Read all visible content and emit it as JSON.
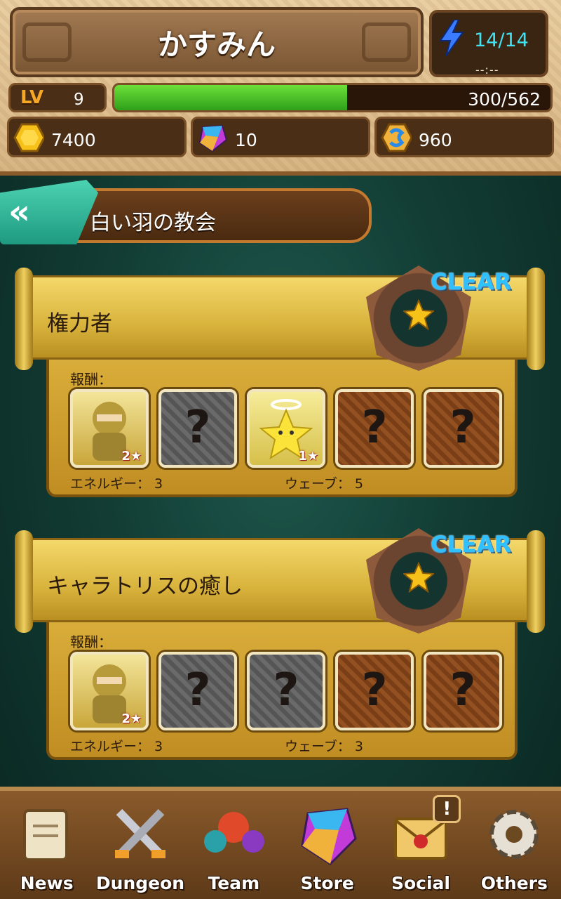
{
  "header": {
    "player_name": "かすみん",
    "stamina": "14/14",
    "stamina_timer": "--:--",
    "level_tag": "LV",
    "level": "9",
    "exp_text": "300/562",
    "exp_progress": 0.534,
    "currencies": {
      "gold": "7400",
      "gems": "10",
      "tickets": "960"
    }
  },
  "area": {
    "title": "白い羽の教会"
  },
  "quests": [
    {
      "title": "権力者",
      "status": "CLEAR",
      "reward_label": "報酬：",
      "rewards": [
        {
          "type": "ninja",
          "rarity": "2★"
        },
        {
          "type": "unknown-silver",
          "symbol": "?"
        },
        {
          "type": "angel-star",
          "rarity": "1★"
        },
        {
          "type": "unknown-bronze",
          "symbol": "?"
        },
        {
          "type": "unknown-bronze",
          "symbol": "?"
        }
      ],
      "energy": "エネルギー： 3",
      "waves": "ウェーブ： 5"
    },
    {
      "title": "キャラトリスの癒し",
      "status": "CLEAR",
      "reward_label": "報酬：",
      "rewards": [
        {
          "type": "ninja",
          "rarity": "2★"
        },
        {
          "type": "unknown-silver",
          "symbol": "?"
        },
        {
          "type": "unknown-silver",
          "symbol": "?"
        },
        {
          "type": "unknown-bronze",
          "symbol": "?"
        },
        {
          "type": "unknown-bronze",
          "symbol": "?"
        }
      ],
      "energy": "エネルギー： 3",
      "waves": "ウェーブ： 3"
    }
  ],
  "nav": {
    "items": [
      {
        "label": "News",
        "icon": "scroll-icon"
      },
      {
        "label": "Dungeon",
        "icon": "crossed-swords-icon"
      },
      {
        "label": "Team",
        "icon": "monsters-icon"
      },
      {
        "label": "Store",
        "icon": "gem-icon"
      },
      {
        "label": "Social",
        "icon": "letter-icon",
        "badge": "!"
      },
      {
        "label": "Others",
        "icon": "gear-icon"
      }
    ]
  },
  "colors": {
    "accent_teal": "#1e9a80",
    "clear_blue": "#2fc0ff",
    "exp_green": "#2ea01a",
    "stamina_cyan": "#3fe3f3"
  }
}
